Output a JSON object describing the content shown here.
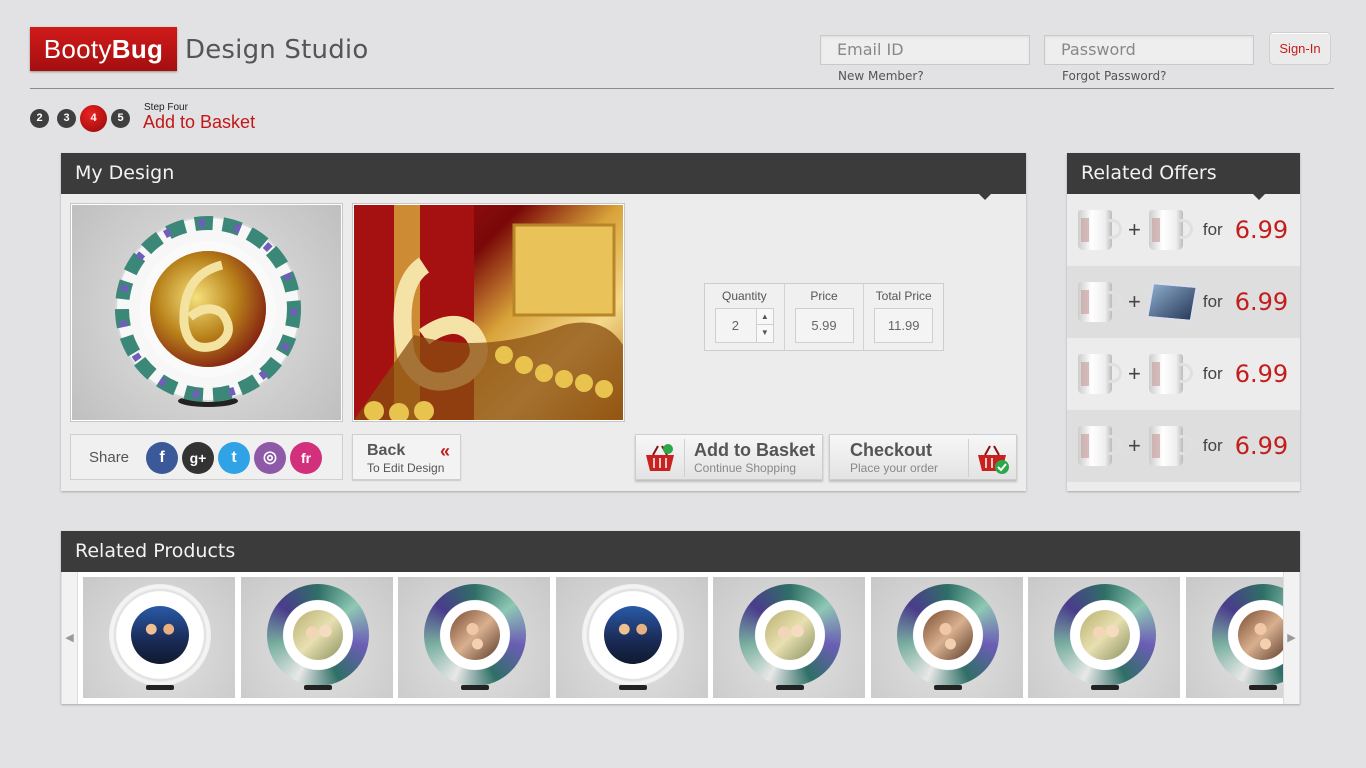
{
  "header": {
    "brand_light": "Booty",
    "brand_bold": "Bug",
    "subtitle": "Design Studio",
    "email_placeholder": "Email ID",
    "password_placeholder": "Password",
    "new_member": "New Member?",
    "forgot_password": "Forgot Password?",
    "signin_label": "Sign-In"
  },
  "steps": {
    "items": [
      "2",
      "3",
      "4",
      "5"
    ],
    "active": "4",
    "current_small": "Step Four",
    "current_title": "Add to Basket"
  },
  "my_design": {
    "title": "My Design",
    "quantity_label": "Quantity",
    "quantity_value": "2",
    "price_label": "Price",
    "price_value": "5.99",
    "total_label": "Total Price",
    "total_value": "11.99",
    "share_label": "Share",
    "social": [
      {
        "name": "facebook-icon",
        "glyph": "f",
        "color": "#3b5998"
      },
      {
        "name": "google-plus-icon",
        "glyph": "g+",
        "color": "#333333"
      },
      {
        "name": "twitter-icon",
        "glyph": "t",
        "color": "#2fa3e6"
      },
      {
        "name": "picasa-icon",
        "glyph": "◎",
        "color": "#8e5aa8"
      },
      {
        "name": "formspring-icon",
        "glyph": "fr",
        "color": "#d2307c"
      }
    ],
    "back_title": "Back",
    "back_sub": "To Edit Design",
    "add_title": "Add to Basket",
    "add_sub": "Continue Shopping",
    "checkout_title": "Checkout",
    "checkout_sub": "Place your order"
  },
  "related_offers": {
    "title": "Related Offers",
    "items": [
      {
        "first": "mug",
        "second": "mug",
        "for": "for",
        "price": "6.99"
      },
      {
        "first": "mug",
        "second": "mousepad",
        "for": "for",
        "price": "6.99"
      },
      {
        "first": "mug",
        "second": "mug",
        "for": "for",
        "price": "6.99"
      },
      {
        "first": "mug",
        "second": "mug",
        "for": "for",
        "price": "6.99"
      }
    ]
  },
  "related_products": {
    "title": "Related Products",
    "items": [
      {
        "rim": "white",
        "photo": "book-couple"
      },
      {
        "rim": "floral",
        "photo": "elderly-couple"
      },
      {
        "rim": "floral",
        "photo": "mother-child"
      },
      {
        "rim": "white",
        "photo": "book-couple"
      },
      {
        "rim": "floral",
        "photo": "elderly-couple"
      },
      {
        "rim": "floral",
        "photo": "mother-child"
      },
      {
        "rim": "floral",
        "photo": "elderly-couple"
      },
      {
        "rim": "floral",
        "photo": "mother-child"
      }
    ]
  },
  "colors": {
    "brand_red": "#c31d1d",
    "header_dark": "#3b3b3b",
    "background": "#e2e1e3"
  }
}
